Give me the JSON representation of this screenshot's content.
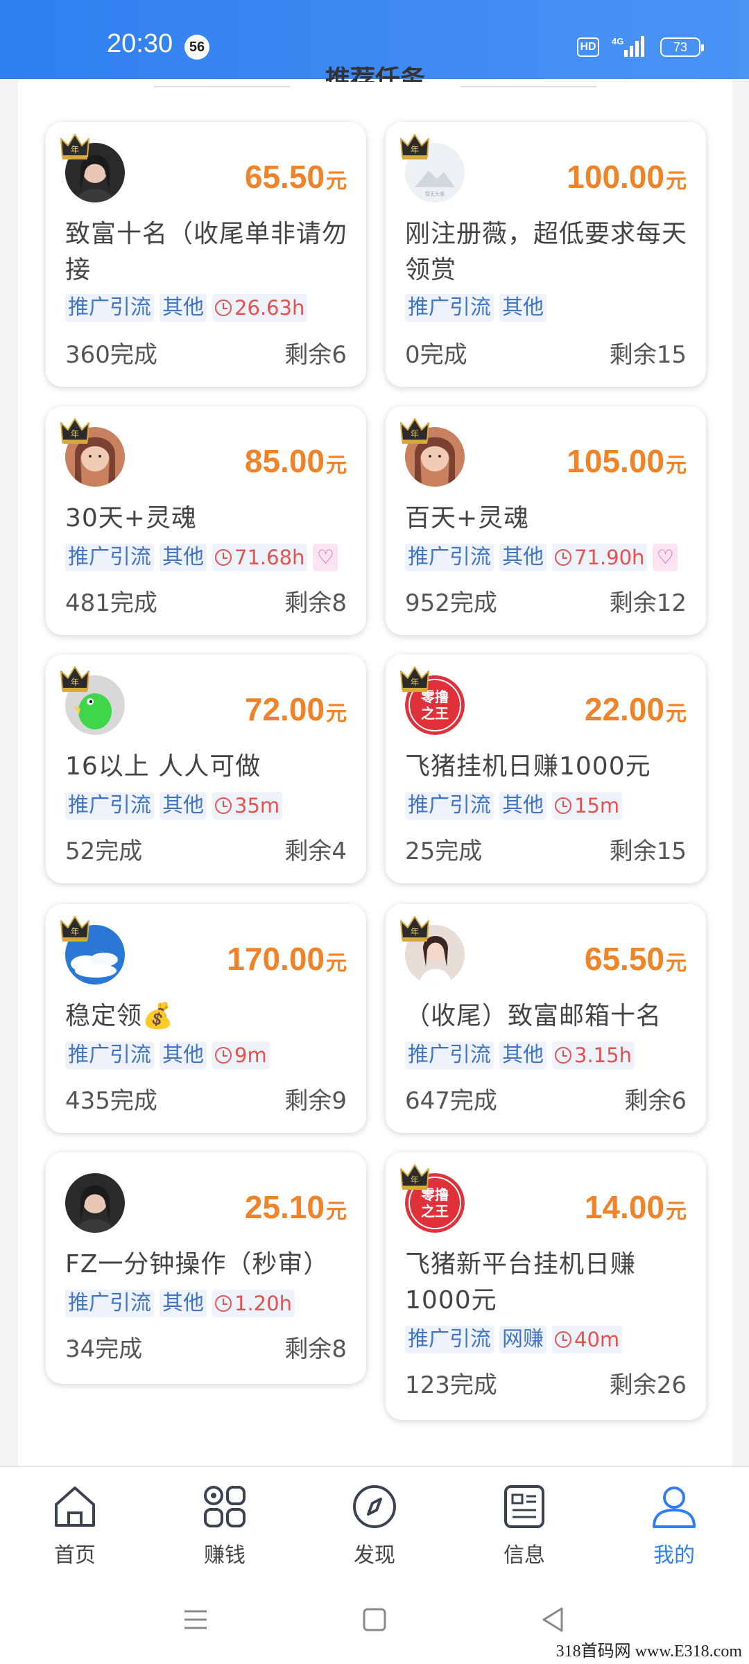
{
  "status_bar": {
    "time": "20:30",
    "badge": "56",
    "hd": "HD",
    "network": "4G",
    "battery": "73"
  },
  "section": {
    "title": "推荐任务"
  },
  "tasks": [
    {
      "price": "65.50",
      "unit": "元",
      "title": "致富十名（收尾单非请勿接",
      "tags": [
        "推广引流",
        "其他"
      ],
      "time": "26.63h",
      "heart": false,
      "completed": "360完成",
      "remaining": "剩余6",
      "avatar": "photo-dark"
    },
    {
      "price": "100.00",
      "unit": "元",
      "title": "刚注册薇，超低要求每天领赏",
      "tags": [
        "推广引流",
        "其他"
      ],
      "time": "",
      "heart": false,
      "completed": "0完成",
      "remaining": "剩余15",
      "avatar": "placeholder"
    },
    {
      "price": "85.00",
      "unit": "元",
      "title": "30天+灵魂",
      "tags": [
        "推广引流",
        "其他"
      ],
      "time": "71.68h",
      "heart": true,
      "completed": "481完成",
      "remaining": "剩余8",
      "avatar": "photo-warm"
    },
    {
      "price": "105.00",
      "unit": "元",
      "title": "百天+灵魂",
      "tags": [
        "推广引流",
        "其他"
      ],
      "time": "71.90h",
      "heart": true,
      "completed": "952完成",
      "remaining": "剩余12",
      "avatar": "photo-warm"
    },
    {
      "price": "72.00",
      "unit": "元",
      "title": "16以上 人人可做",
      "tags": [
        "推广引流",
        "其他"
      ],
      "time": "35m",
      "heart": false,
      "completed": "52完成",
      "remaining": "剩余4",
      "avatar": "green-bird"
    },
    {
      "price": "22.00",
      "unit": "元",
      "title": "飞猪挂机日赚1000元",
      "tags": [
        "推广引流",
        "其他"
      ],
      "time": "15m",
      "heart": false,
      "completed": "25完成",
      "remaining": "剩余15",
      "avatar": "red-badge",
      "avatar_text": "零撸之王"
    },
    {
      "price": "170.00",
      "unit": "元",
      "title": "稳定领💰",
      "tags": [
        "推广引流",
        "其他"
      ],
      "time": "9m",
      "heart": false,
      "completed": "435完成",
      "remaining": "剩余9",
      "avatar": "sky"
    },
    {
      "price": "65.50",
      "unit": "元",
      "title": "（收尾）致富邮箱十名",
      "tags": [
        "推广引流",
        "其他"
      ],
      "time": "3.15h",
      "heart": false,
      "completed": "647完成",
      "remaining": "剩余6",
      "avatar": "photo-light"
    },
    {
      "price": "25.10",
      "unit": "元",
      "title": "FZ一分钟操作（秒审）",
      "tags": [
        "推广引流",
        "其他"
      ],
      "time": "1.20h",
      "heart": false,
      "completed": "34完成",
      "remaining": "剩余8",
      "avatar": "photo-dark"
    },
    {
      "price": "14.00",
      "unit": "元",
      "title": "飞猪新平台挂机日赚1000元",
      "tags": [
        "推广引流",
        "网赚"
      ],
      "time": "40m",
      "heart": false,
      "completed": "123完成",
      "remaining": "剩余26",
      "avatar": "red-badge",
      "avatar_text": "零撸之王"
    }
  ],
  "bottom_nav": [
    {
      "label": "首页",
      "icon": "home-icon",
      "active": false
    },
    {
      "label": "赚钱",
      "icon": "grid-icon",
      "active": false
    },
    {
      "label": "发现",
      "icon": "compass-icon",
      "active": false
    },
    {
      "label": "信息",
      "icon": "news-icon",
      "active": false
    },
    {
      "label": "我的",
      "icon": "user-icon",
      "active": true
    }
  ],
  "colors": {
    "accent": "#2f7ff0",
    "price": "#f08228",
    "tag_text": "#4174c5",
    "time_tag": "#e6514c"
  },
  "watermark": "318首码网 www.E318.com"
}
